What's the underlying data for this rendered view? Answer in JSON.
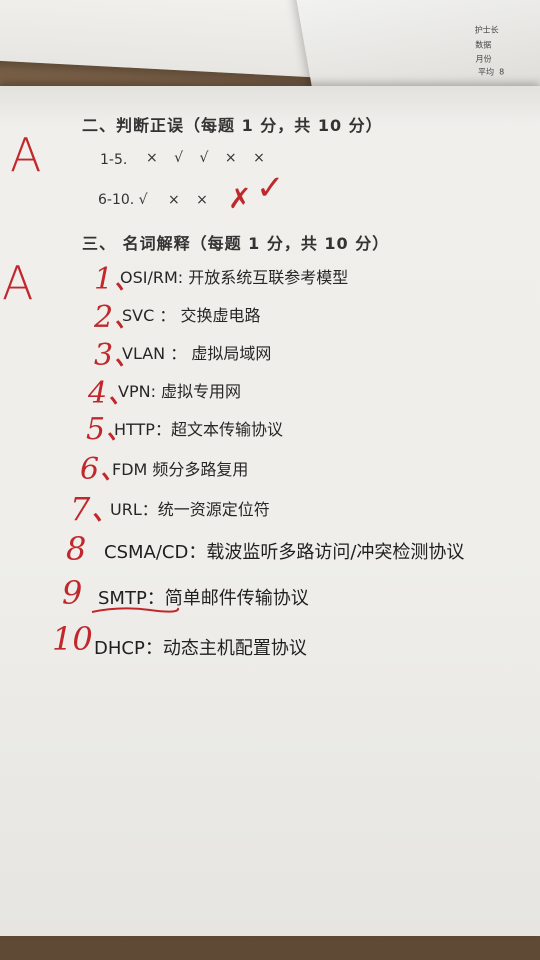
{
  "background": {
    "table_color": "#6b5a47",
    "paper_color": "#efeeea",
    "ink_color": "#2b2b2b",
    "red_ink": "#c0282c",
    "corner_scribbles": [
      "护士长",
      "数据",
      "月份",
      "平均  8"
    ]
  },
  "section_2": {
    "title": "二、判断正误（每题 1 分，共 10 分）",
    "rows": [
      {
        "label": "1-5.",
        "marks": "×  √  √  ×  ×"
      },
      {
        "label": "6-10. √",
        "marks": "×    ×"
      }
    ],
    "grade": "A",
    "correction_cross": "✗",
    "correction_check": "✓"
  },
  "section_3": {
    "title": "三、  名词解释（每题 1 分，共 10 分）",
    "grade": "A",
    "items": [
      {
        "num": "1、",
        "term": "OSI/RM:  开放系统互联参考模型"
      },
      {
        "num": "2、",
        "term": "SVC ：  交换虚电路"
      },
      {
        "num": "3、",
        "term": "VLAN ：  虚拟局域网"
      },
      {
        "num": "4、",
        "term": "VPN:     虚拟专用网"
      },
      {
        "num": "5、",
        "term": "HTTP：超文本传输协议"
      },
      {
        "num": "6、",
        "term": "FDM    频分多路复用"
      },
      {
        "num": "7、",
        "term": "URL：统一资源定位符"
      },
      {
        "num": "8",
        "term": "CSMA/CD：载波监听多路访问/冲突检测协议"
      },
      {
        "num": "9",
        "term": "SMTP：简单邮件传输协议"
      },
      {
        "num": "10",
        "term": "DHCP：动态主机配置协议"
      }
    ]
  }
}
